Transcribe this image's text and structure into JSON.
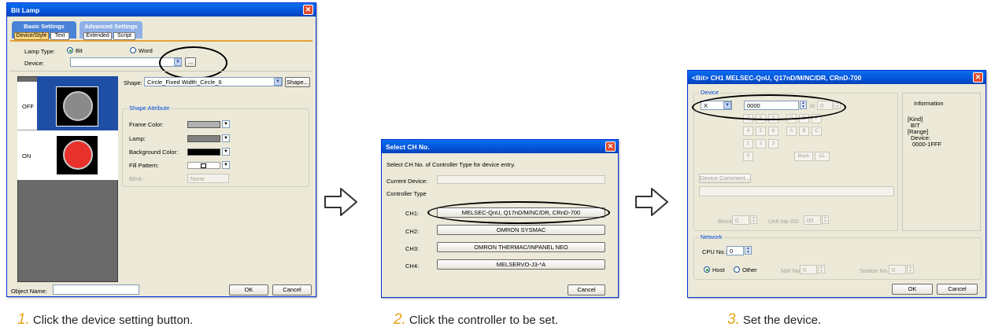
{
  "dialog1": {
    "title": "Bit Lamp",
    "tab_basic": "Basic Settings",
    "tab_advanced": "Advanced Settings",
    "subtab_device_style": "Device/Style",
    "subtab_text": "Text",
    "subtab_extended": "Extended",
    "subtab_script": "Script",
    "lamp_type_label": "Lamp Type:",
    "lamp_type_bit": "Bit",
    "lamp_type_word": "Word",
    "lamp_type_selected": "Bit",
    "device_label": "Device:",
    "device_value": "",
    "browse_label": "...",
    "shape_label": "Shape:",
    "shape_value": "Circle_Fixed Width_Circle_6",
    "shape_button": "Shape...",
    "state_off": "OFF",
    "state_on": "ON",
    "shape_attribute_title": "Shape Attribute",
    "frame_color_label": "Frame Color:",
    "lamp_label": "Lamp:",
    "background_color_label": "Background Color:",
    "fill_pattern_label": "Fill Pattern:",
    "blink_label": "Blink:",
    "blink_value": "None",
    "object_name_label": "Object Name:",
    "object_name_value": "",
    "ok": "OK",
    "cancel": "Cancel",
    "colors": {
      "frame": "#b0b0b0",
      "lamp": "#808080",
      "background": "#000000",
      "lamp_off": "#8a8a8a",
      "lamp_on": "#e8312a",
      "selected_state": "#1f4fa5"
    }
  },
  "dialog2": {
    "title": "Select CH No.",
    "instruction": "Select CH No. of Controller Type for device entry.",
    "current_device_label": "Current Device:",
    "current_device_value": "",
    "controller_type_label": "Controller Type",
    "channels": [
      {
        "label": "CH1:",
        "controller": "MELSEC-QnU, Q17nD/M/NC/DR, CRnD-700"
      },
      {
        "label": "CH2:",
        "controller": "OMRON SYSMAC"
      },
      {
        "label": "CH3:",
        "controller": "OMRON THERMAC/INPANEL NEO"
      },
      {
        "label": "CH4:",
        "controller": "MELSERVO-J3-*A"
      }
    ],
    "cancel": "Cancel"
  },
  "dialog3": {
    "title": "<Bit> CH1 MELSEC-QnU, Q17nD/M/NC/DR, CRnD-700",
    "device_group": "Device",
    "device_type": "X",
    "device_number": "0000",
    "to_label": "to",
    "to_value": "0",
    "keypad_rows": [
      [
        "7",
        "8",
        "9",
        "D",
        "E",
        "F"
      ],
      [
        "4",
        "5",
        "6",
        "A",
        "B",
        "C"
      ],
      [
        "1",
        "2",
        "3"
      ],
      [
        "0"
      ]
    ],
    "back": "Back",
    "clear": "CL",
    "device_comment_button": "Device Comment...",
    "device_comment_value": "",
    "block_label": "Block:",
    "block_value": "0",
    "unit_io_label": "Unit top I/O:",
    "unit_io_value": "00",
    "information_title": "Information",
    "information_lines": [
      "[Kind]",
      "BIT",
      "[Range]",
      "Device:",
      "0000-1FFF"
    ],
    "network_group": "Network",
    "cpu_no_label": "CPU No.:",
    "cpu_no_value": "0",
    "host_label": "Host",
    "other_label": "Other",
    "network_selected": "Host",
    "nw_no_label": "NW No.:",
    "nw_no_value": "0",
    "station_no_label": "Station No.:",
    "station_no_value": "0",
    "ok": "OK",
    "cancel": "Cancel"
  },
  "steps": [
    {
      "num": "1.",
      "text": "Click the device setting button."
    },
    {
      "num": "2.",
      "text": "Click the controller to be set."
    },
    {
      "num": "3.",
      "text": "Set the device."
    }
  ]
}
